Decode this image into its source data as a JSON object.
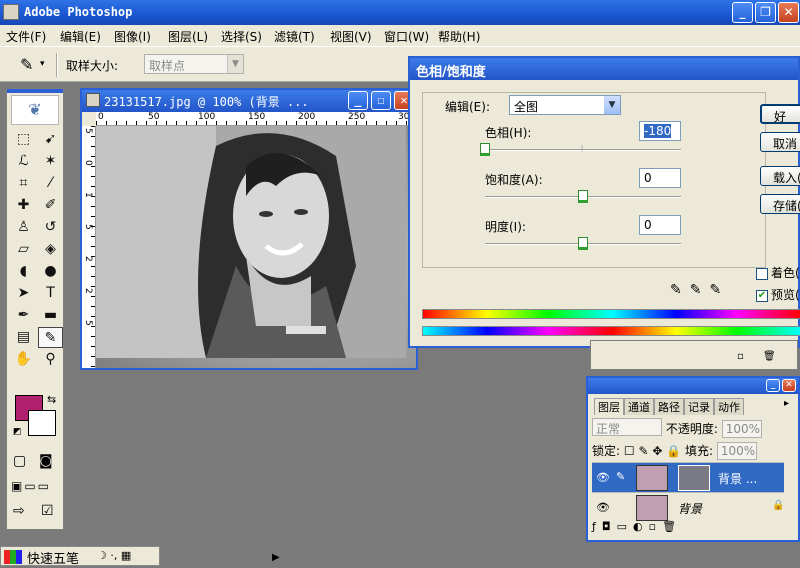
{
  "app": {
    "title": "Adobe Photoshop"
  },
  "menu": [
    "文件(F)",
    "编辑(E)",
    "图像(I)",
    "图层(L)",
    "选择(S)",
    "滤镜(T)",
    "视图(V)",
    "窗口(W)",
    "帮助(H)"
  ],
  "options": {
    "sample_size_label": "取样大小:",
    "sample_size_value": "取样点"
  },
  "document": {
    "title": "23131517.jpg @ 100% (背景 ...",
    "ruler_h": [
      "0",
      "50",
      "100",
      "150",
      "200",
      "250",
      "300"
    ],
    "ruler_v": [
      "5",
      "0",
      "1",
      "5",
      "2",
      "2",
      "5"
    ]
  },
  "hue_sat": {
    "title": "色相/饱和度",
    "edit_label": "编辑(E):",
    "edit_value": "全图",
    "hue_label": "色相(H):",
    "hue_value": "-180",
    "hue_level": -180,
    "saturation_label": "饱和度(A):",
    "saturation_value": "0",
    "saturation_level": 0,
    "lightness_label": "明度(I):",
    "lightness_value": "0",
    "lightness_level": 0,
    "buttons": {
      "ok": "好",
      "cancel": "取消",
      "load": "载入(",
      "save": "存储("
    },
    "colorize_label": "着色(",
    "preview_label": "预览(",
    "preview_checked": true
  },
  "layers_panel": {
    "tabs": [
      "图层",
      "通道",
      "路径",
      "记录",
      "动作"
    ],
    "blend_mode": "正常",
    "opacity_label": "不透明度:",
    "opacity_value": "100%",
    "lock_label": "锁定:",
    "fill_label": "填充:",
    "fill_value": "100%",
    "layers": [
      {
        "name": "背景 ...",
        "active": true
      },
      {
        "name": "背景",
        "active": false
      }
    ]
  },
  "ime": {
    "name": "快速五笔"
  },
  "colors": {
    "foreground": "#b0206f",
    "background": "#ffffff",
    "accent": "#2b5fd6"
  }
}
